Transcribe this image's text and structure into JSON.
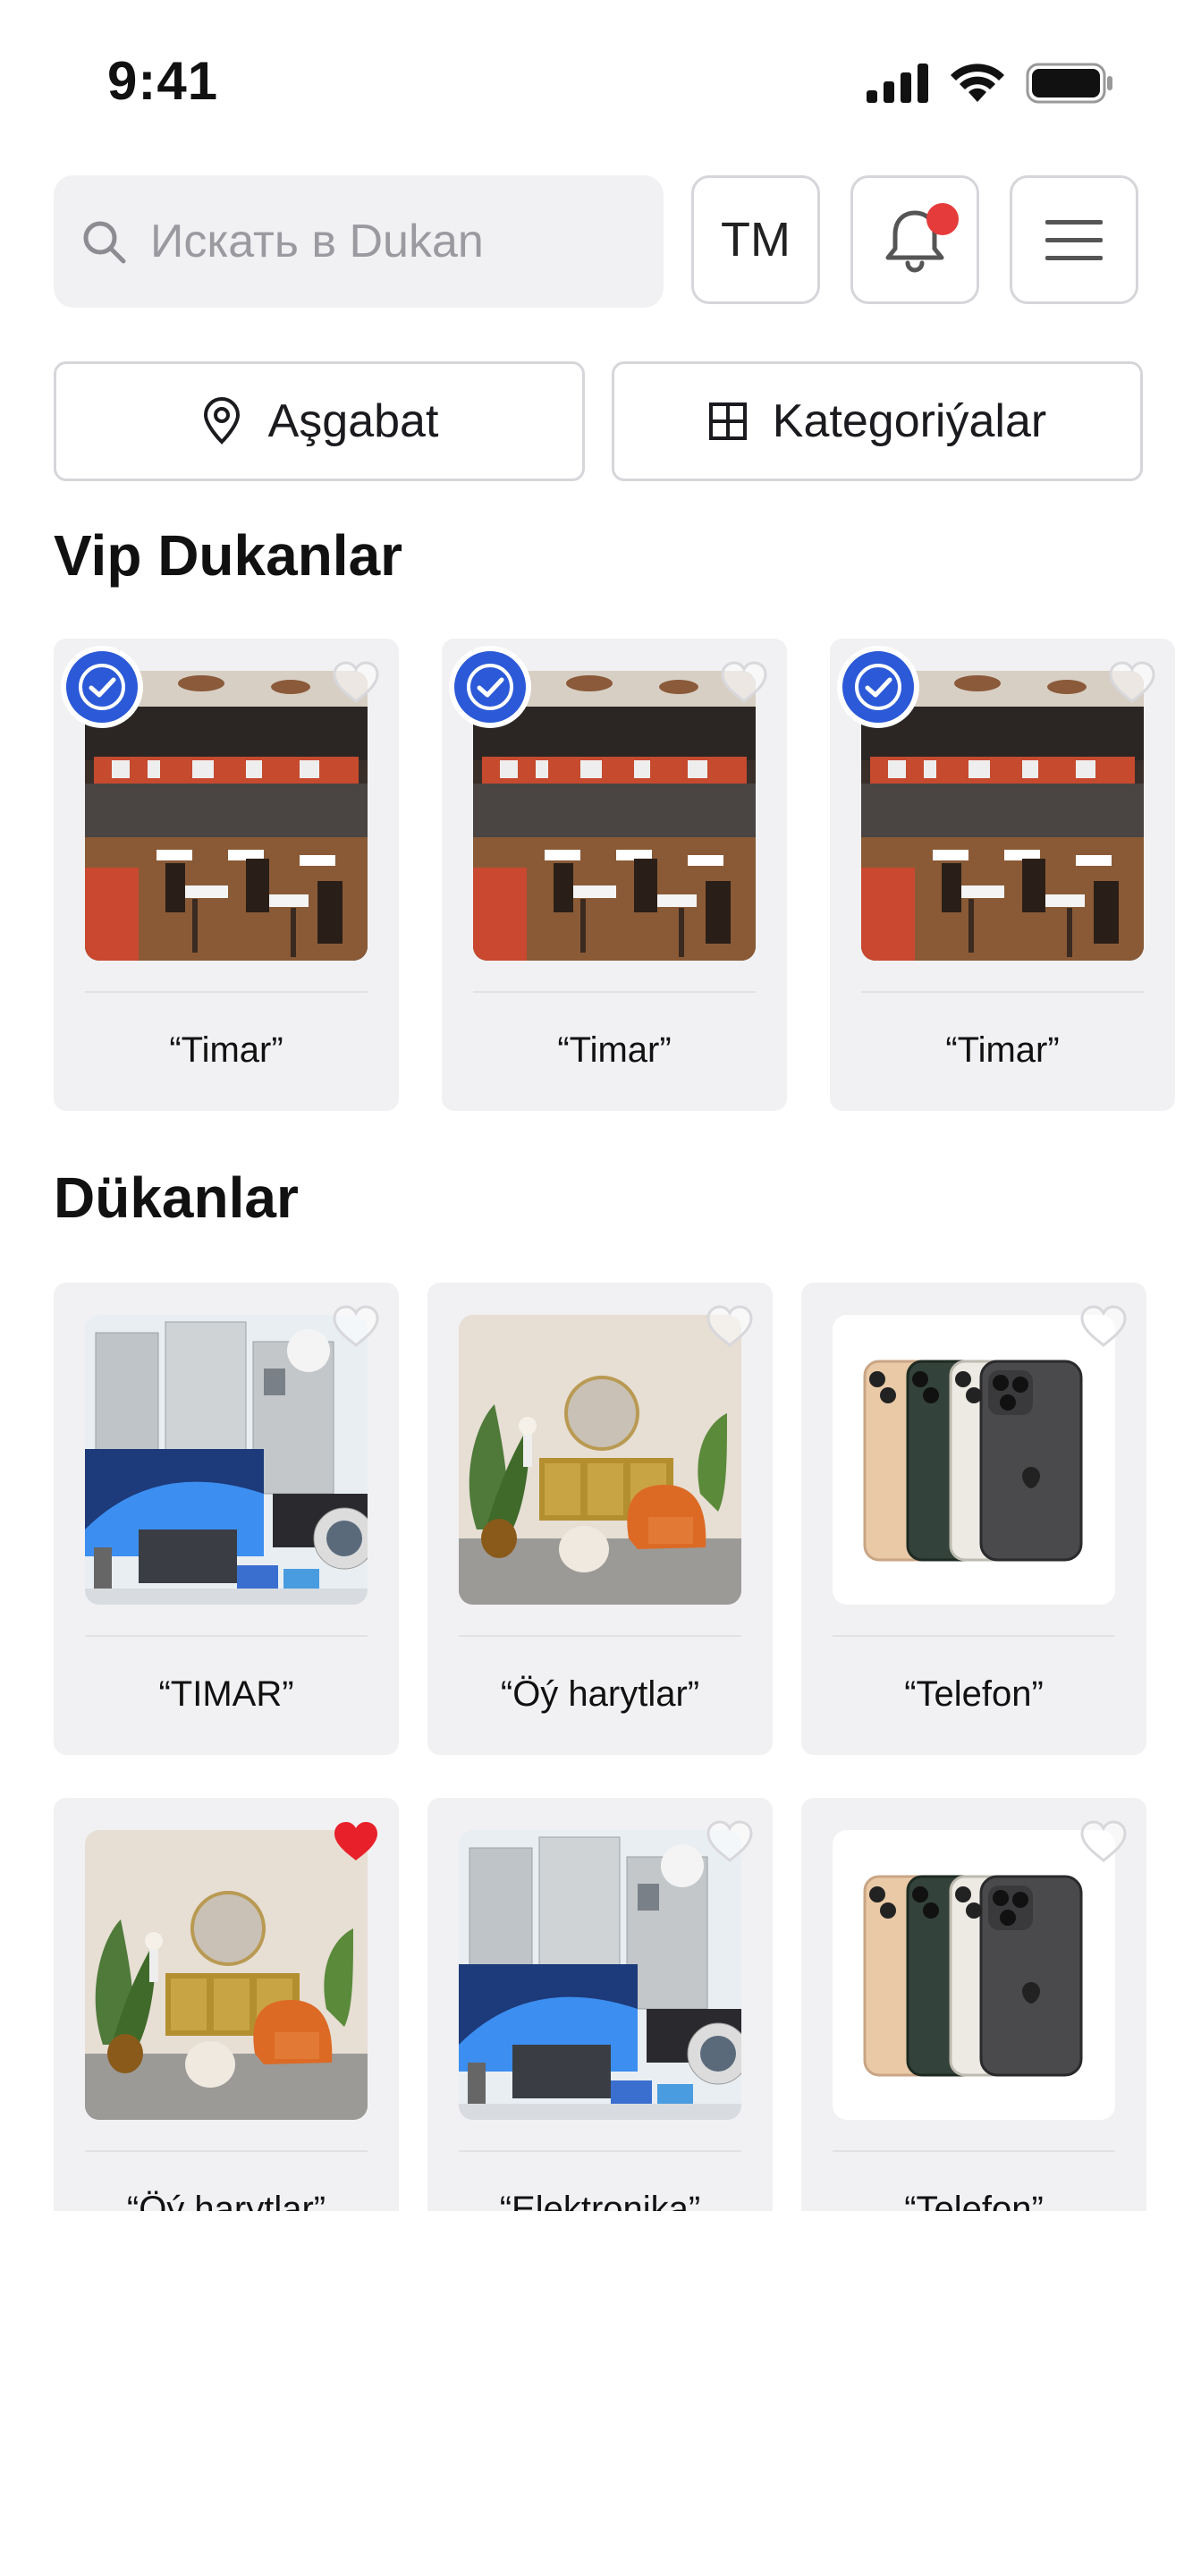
{
  "status_bar": {
    "time": "9:41"
  },
  "search": {
    "placeholder": "Искать в Dukan"
  },
  "header": {
    "language_label": "TM"
  },
  "filters": {
    "location_label": "Aşgabat",
    "categories_label": "Kategoriýalar"
  },
  "vip_section": {
    "title": "Vip Dukanlar",
    "items": [
      {
        "name": "“Timar”",
        "verified": true,
        "favorited": false,
        "image": "restaurant"
      },
      {
        "name": "“Timar”",
        "verified": true,
        "favorited": false,
        "image": "restaurant"
      },
      {
        "name": "“Timar”",
        "verified": true,
        "favorited": false,
        "image": "restaurant"
      }
    ]
  },
  "shops_section": {
    "title": "Dükanlar",
    "items": [
      {
        "name": "“TIMAR”",
        "favorited": false,
        "image": "appliances"
      },
      {
        "name": "“Öý harytlar”",
        "favorited": false,
        "image": "living-room"
      },
      {
        "name": "“Telefon”",
        "favorited": false,
        "image": "phones"
      },
      {
        "name": "“Öý harytlar”",
        "favorited": true,
        "image": "living-room"
      },
      {
        "name": "“Elektronika”",
        "favorited": false,
        "image": "appliances"
      },
      {
        "name": "“Telefon”",
        "favorited": false,
        "image": "phones"
      }
    ]
  },
  "colors": {
    "accent_blue": "#2b59d8",
    "notification_red": "#e63b3b",
    "favorite_red": "#e8202a",
    "card_background": "#f1f1f3"
  }
}
